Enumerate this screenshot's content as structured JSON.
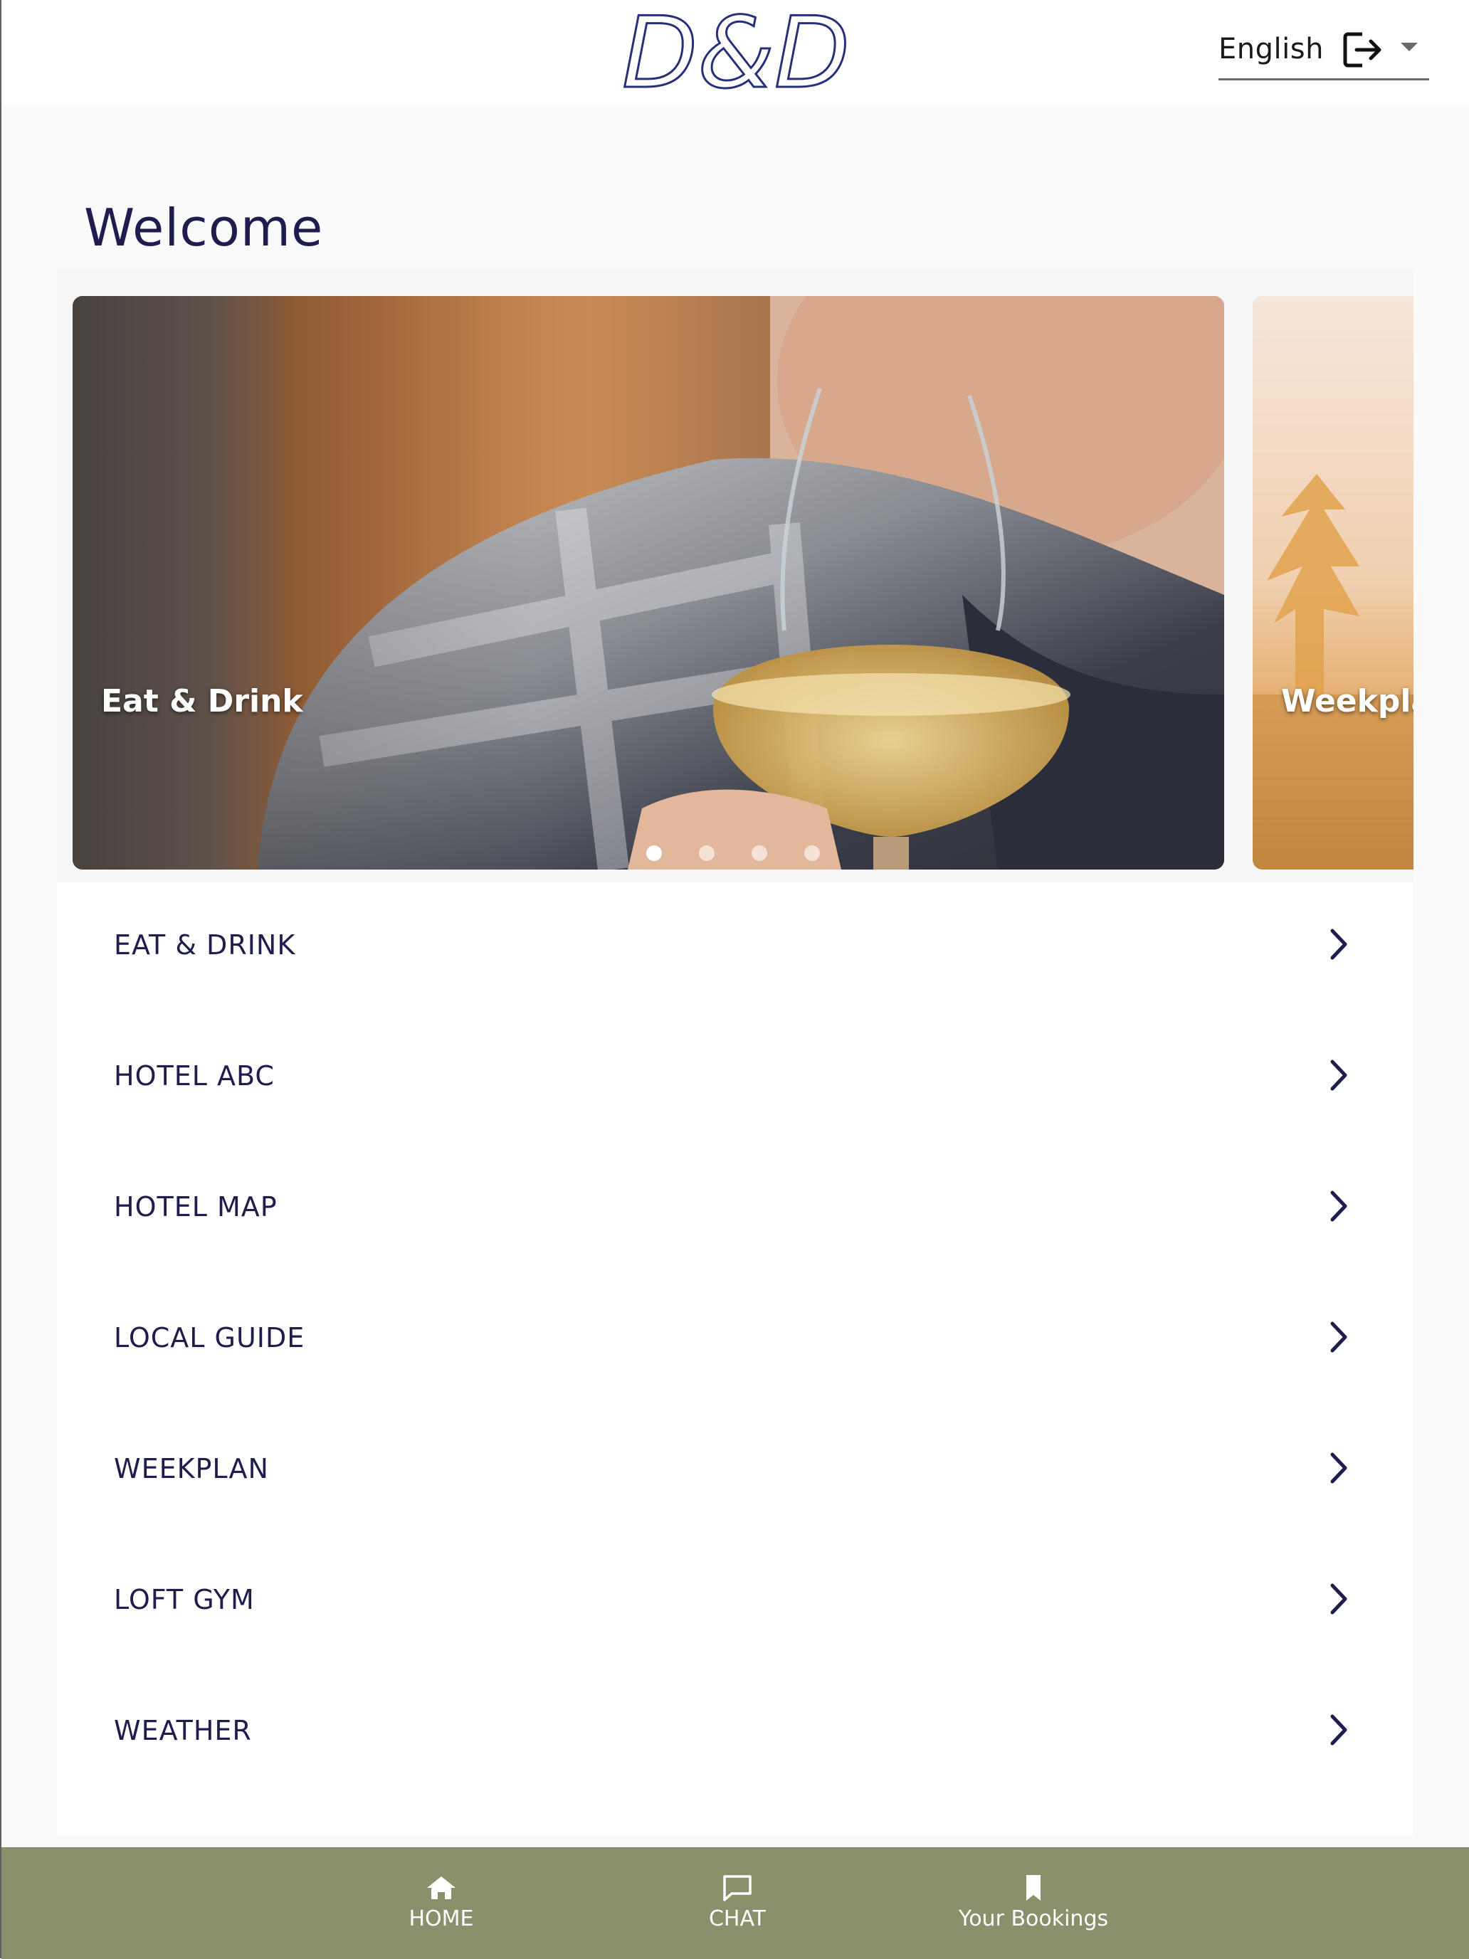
{
  "header": {
    "logo_text": "D&D",
    "language": "English"
  },
  "welcome": "Welcome",
  "carousel": {
    "slides": [
      {
        "label": "Eat & Drink"
      },
      {
        "label": "Weekpla"
      }
    ],
    "dot_count": 4,
    "active_dot": 1
  },
  "menu": {
    "items": [
      {
        "label": "EAT & DRINK"
      },
      {
        "label": "HOTEL ABC"
      },
      {
        "label": "HOTEL MAP"
      },
      {
        "label": "LOCAL GUIDE"
      },
      {
        "label": "WEEKPLAN"
      },
      {
        "label": "LOFT GYM"
      },
      {
        "label": "WEATHER"
      }
    ]
  },
  "bottom_nav": {
    "items": [
      {
        "label": "HOME",
        "icon": "home-icon"
      },
      {
        "label": "CHAT",
        "icon": "chat-icon"
      },
      {
        "label": "Your Bookings",
        "icon": "bookmark-icon"
      }
    ]
  },
  "colors": {
    "brand_navy": "#1f1d4d",
    "nav_bar": "#8a8f6c",
    "background": "#fafafa"
  }
}
